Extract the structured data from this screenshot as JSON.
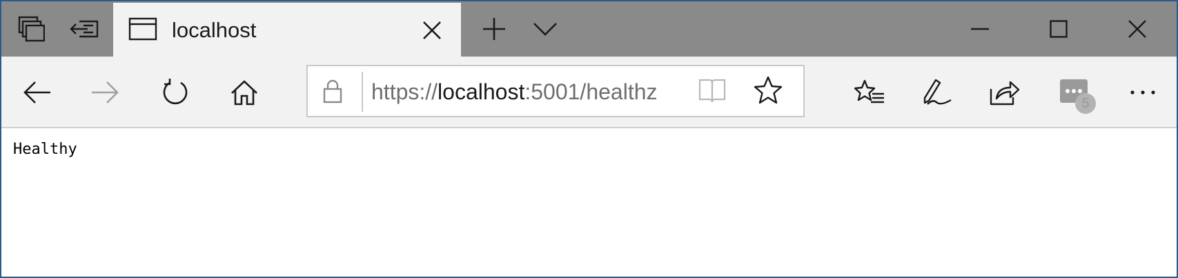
{
  "tab": {
    "title": "localhost"
  },
  "address_bar": {
    "scheme": "https://",
    "host": "localhost",
    "rest": ":5001/healthz"
  },
  "page": {
    "body_text": "Healthy"
  },
  "extensions": {
    "badge_count": "5"
  },
  "icons": [
    "tab-manager-icon",
    "set-aside-tabs-icon",
    "tab-page-icon",
    "close-icon",
    "new-tab-icon",
    "chevron-down-icon",
    "minimize-icon",
    "maximize-icon",
    "window-close-icon",
    "back-icon",
    "forward-icon",
    "refresh-icon",
    "home-icon",
    "lock-icon",
    "reading-view-icon",
    "favorite-star-icon",
    "favorites-list-icon",
    "pen-icon",
    "share-icon",
    "extension-icon",
    "more-icon"
  ],
  "colors": {
    "titlebar": "#8a8a8a",
    "tab_active": "#f2f2f2",
    "navbar": "#f2f2f2",
    "window_border": "#2b5b8a"
  }
}
